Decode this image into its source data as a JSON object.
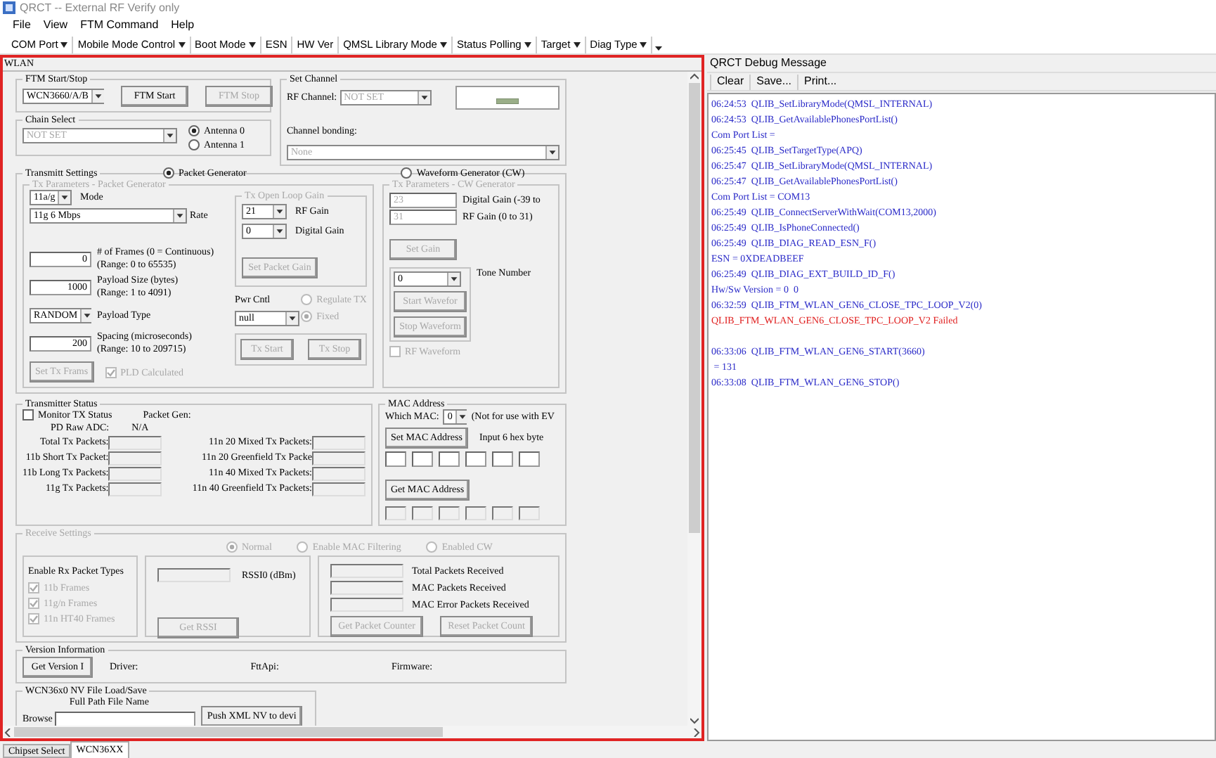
{
  "window": {
    "title": "QRCT -- External RF Verify only"
  },
  "menu": [
    "File",
    "View",
    "FTM Command",
    "Help"
  ],
  "toolbar": [
    {
      "label": "COM Port",
      "dropdown": true
    },
    {
      "label": "Mobile Mode Control",
      "dropdown": true
    },
    {
      "label": "Boot Mode",
      "dropdown": true
    },
    {
      "label": "ESN",
      "dropdown": false
    },
    {
      "label": "HW Ver",
      "dropdown": false
    },
    {
      "label": "QMSL Library Mode",
      "dropdown": true
    },
    {
      "label": "Status Polling",
      "dropdown": true
    },
    {
      "label": "Target",
      "dropdown": true
    },
    {
      "label": "Diag Type",
      "dropdown": true
    }
  ],
  "wlan": {
    "title": "WLAN",
    "ftm": {
      "title": "FTM Start/Stop",
      "chip": "WCN3660/A/B",
      "buttons": [
        {
          "label": "FTM Start",
          "disabled": false
        },
        {
          "label": "FTM Stop",
          "disabled": true
        }
      ]
    },
    "set_channel": {
      "title": "Set Channel",
      "rf_channel_label": "RF Channel:",
      "rf_channel": "NOT SET",
      "bonding_label": "Channel bonding:",
      "bonding": "None"
    },
    "chain_select": {
      "title": "Chain Select",
      "chain": "NOT SET",
      "antennas": [
        {
          "label": "Antenna 0",
          "selected": true
        },
        {
          "label": "Antenna 1",
          "selected": false
        }
      ]
    },
    "transmit": {
      "title": "Transmitt Settings",
      "generators": [
        {
          "label": "Packet Generator",
          "selected": true
        },
        {
          "label": "Waveform Generator (CW)",
          "selected": false
        }
      ],
      "packet": {
        "title": "Tx Parameters - Packet Generator",
        "mode": "11a/g",
        "mode_label": "Mode",
        "rate": "11g 6 Mbps",
        "rate_label": "Rate",
        "params": [
          {
            "kind": "input",
            "value": "0",
            "label": "# of Frames (0 = Continuous)",
            "range": "(Range: 0 to 65535)"
          },
          {
            "kind": "input",
            "value": "1000",
            "label": "Payload Size (bytes)",
            "range": "(Range: 1 to 4091)"
          },
          {
            "kind": "select",
            "value": "RANDOM",
            "label": "Payload Type"
          },
          {
            "kind": "input",
            "value": "200",
            "label": "Spacing (microseconds)",
            "range": "(Range: 10 to 209715)"
          }
        ],
        "set_button": "Set Tx Frams",
        "pld": {
          "label": "PLD Calculated",
          "checked": true
        },
        "gain": {
          "title": "Tx Open Loop Gain",
          "rf_gain": "21",
          "rf_gain_label": "RF Gain",
          "digital_gain": "0",
          "digital_gain_label": "Digital Gain",
          "button": "Set Packet Gain"
        },
        "pwr_label": "Pwr Cntl",
        "pwr_mode": "null",
        "pwr_options": [
          {
            "label": "Regulate TX",
            "selected": false
          },
          {
            "label": "Fixed",
            "selected": true
          }
        ],
        "buttons": [
          "Tx Start",
          "Tx Stop"
        ]
      },
      "cw": {
        "title": "Tx Parameters - CW Generator",
        "digital_gain": "23",
        "digital_gain_label": "Digital Gain (-39 to",
        "rf_gain": "31",
        "rf_gain_label": "RF Gain (0 to 31)",
        "button": "Set Gain",
        "tone": "0",
        "tone_label": "Tone Number",
        "buttons": [
          "Start Wavefor",
          "Stop Waveform"
        ],
        "rf_waveform": {
          "label": "RF Waveform",
          "checked": false
        }
      }
    },
    "tx_status": {
      "title": "Transmitter Status",
      "monitor": {
        "label": "Monitor TX Status",
        "checked": false
      },
      "packet_gen_label": "Packet Gen:",
      "pd_raw_label": "PD Raw ADC:",
      "pd_raw": "N/A",
      "counters_left": [
        "Total Tx Packets:",
        "11b Short Tx Packet:",
        "11b Long Tx Packets:",
        "11g Tx Packets:"
      ],
      "counters_right": [
        "11n 20 Mixed Tx Packets:",
        "11n 20 Greenfield Tx Packe",
        "11n 40 Mixed Tx Packets:",
        "11n 40 Greenfield Tx Packets:"
      ]
    },
    "mac": {
      "title": "MAC Address",
      "which_label": "Which MAC:",
      "which": "0",
      "note": "(Not for use with EV",
      "set_button": "Set MAC Address",
      "input_hint": "Input 6  hex byte",
      "get_button": "Get MAC Address"
    },
    "receive": {
      "title": "Receive Settings",
      "modes": [
        {
          "label": "Normal",
          "selected": true
        },
        {
          "label": "Enable MAC Filtering",
          "selected": false
        },
        {
          "label": "Enabled CW",
          "selected": false
        }
      ],
      "types_title": "Enable Rx Packet Types",
      "types": [
        {
          "label": "11b Frames",
          "checked": true
        },
        {
          "label": "11g/n Frames",
          "checked": true
        },
        {
          "label": "11n HT40 Frames",
          "checked": true
        }
      ],
      "rssi_label": "RSSI0 (dBm)",
      "rssi_button": "Get RSSI",
      "counters": [
        "Total Packets Received",
        "MAC Packets Received",
        "MAC Error Packets Received"
      ],
      "counter_buttons": [
        "Get Packet Counter",
        "Reset Packet Count"
      ]
    },
    "version": {
      "title": "Version Information",
      "button": "Get Version I",
      "fields": [
        "Driver:",
        "FttApi:",
        "Firmware:"
      ]
    },
    "nv": {
      "title": "WCN36x0 NV File Load/Save",
      "path_label": "Full Path File Name",
      "push_button": "Push XML NV to devi",
      "browse_label": "Browse"
    }
  },
  "bottom_tabs": [
    {
      "label": "Chipset Select",
      "selected": false
    },
    {
      "label": "WCN36XX",
      "selected": true
    }
  ],
  "debug": {
    "title": "QRCT Debug Message",
    "buttons": [
      "Clear",
      "Save...",
      "Print..."
    ],
    "lines": [
      {
        "text": "06:24:53  QLIB_SetLibraryMode(QMSL_INTERNAL)",
        "kind": "info"
      },
      {
        "text": "06:24:53  QLIB_GetAvailablePhonesPortList()",
        "kind": "info"
      },
      {
        "text": "Com Port List =",
        "kind": "info"
      },
      {
        "text": "06:25:45  QLIB_SetTargetType(APQ)",
        "kind": "info"
      },
      {
        "text": "06:25:47  QLIB_SetLibraryMode(QMSL_INTERNAL)",
        "kind": "info"
      },
      {
        "text": "06:25:47  QLIB_GetAvailablePhonesPortList()",
        "kind": "info"
      },
      {
        "text": "Com Port List = COM13",
        "kind": "info"
      },
      {
        "text": "06:25:49  QLIB_ConnectServerWithWait(COM13,2000)",
        "kind": "info"
      },
      {
        "text": "06:25:49  QLIB_IsPhoneConnected()",
        "kind": "info"
      },
      {
        "text": "06:25:49  QLIB_DIAG_READ_ESN_F()",
        "kind": "info"
      },
      {
        "text": "ESN = 0XDEADBEEF",
        "kind": "info"
      },
      {
        "text": "06:25:49  QLIB_DIAG_EXT_BUILD_ID_F()",
        "kind": "info"
      },
      {
        "text": "Hw/Sw Version = 0  0",
        "kind": "info"
      },
      {
        "text": "06:32:59  QLIB_FTM_WLAN_GEN6_CLOSE_TPC_LOOP_V2(0)",
        "kind": "info"
      },
      {
        "text": "QLIB_FTM_WLAN_GEN6_CLOSE_TPC_LOOP_V2 Failed",
        "kind": "error"
      },
      {
        "text": "06:33:06  QLIB_FTM_WLAN_GEN6_START(3660)",
        "kind": "info"
      },
      {
        "text": " = 131",
        "kind": "info"
      },
      {
        "text": "06:33:08  QLIB_FTM_WLAN_GEN6_STOP()",
        "kind": "info"
      }
    ]
  }
}
